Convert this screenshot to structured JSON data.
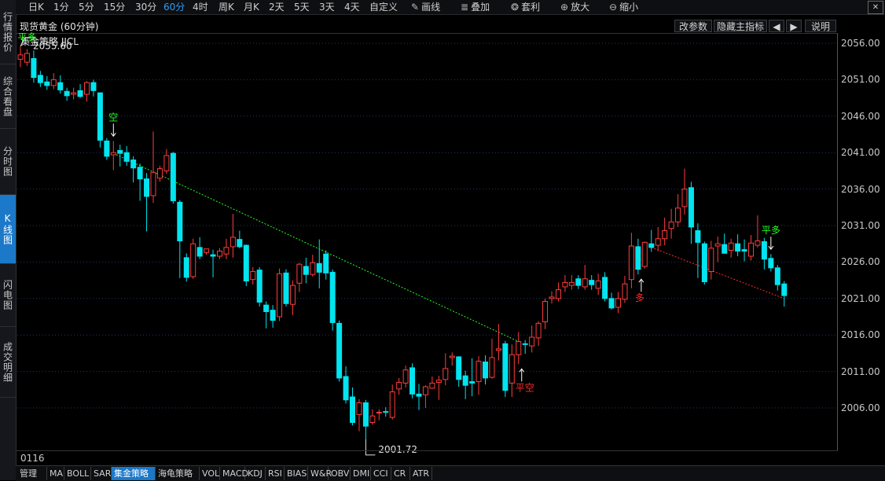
{
  "left_nav": [
    "行情报价",
    "综合看盘",
    "分时图",
    "K线图",
    "闪电图",
    "成交明细"
  ],
  "left_nav_active": 3,
  "periods": [
    "日K",
    "1分",
    "5分",
    "15分",
    "30分",
    "60分",
    "4时",
    "周K",
    "月K",
    "2天",
    "5天",
    "3天",
    "4天",
    "自定义"
  ],
  "period_active": 5,
  "tools": [
    {
      "label": "画线",
      "icon": "pencil-icon",
      "glyph": "✎"
    },
    {
      "label": "叠加",
      "icon": "stack-icon",
      "glyph": "≣"
    },
    {
      "label": "套利",
      "icon": "bag-icon",
      "glyph": "❂"
    },
    {
      "label": "放大",
      "icon": "zoom-in-icon",
      "glyph": "⊕"
    },
    {
      "label": "缩小",
      "icon": "zoom-out-icon",
      "glyph": "⊖"
    }
  ],
  "chart_title": "现货黄金 (60分钟)",
  "title_buttons": {
    "params": "改参数",
    "hide_main": "隐藏主指标",
    "prev": "◀",
    "next": "▶",
    "help": "说明"
  },
  "strategy_label": "集金策略 JJCL",
  "count": "0116",
  "bottom_tabs": [
    "管理",
    "MA",
    "BOLL",
    "SAR",
    "集金策略",
    "海龟策略",
    "VOL",
    "MACD",
    "KDJ",
    "RSI",
    "BIAS",
    "W&R",
    "OBV",
    "DMI",
    "CCI",
    "CR",
    "ATR"
  ],
  "bottom_tab_active": 4,
  "colors": {
    "up": "#ff3c3c",
    "down": "#00e5f0",
    "grid": "#1e3a5f",
    "signal_green": "#22ff22",
    "signal_red": "#ff2a2a"
  },
  "chart_data": {
    "type": "candlestick",
    "y_ticks": [
      "2056.00",
      "2051.00",
      "2046.00",
      "2041.00",
      "2036.00",
      "2031.00",
      "2026.00",
      "2021.00",
      "2016.00",
      "2011.00",
      "2006.00"
    ],
    "ylim": [
      2000,
      2058
    ],
    "high_label": "2055.60",
    "low_label": "2001.72",
    "candles": [
      [
        2053.8,
        2054.4,
        2055.6,
        2052.7
      ],
      [
        2053.4,
        2054.6,
        2055.2,
        2052.9
      ],
      [
        2053.9,
        2051.3,
        2055.0,
        2050.6
      ],
      [
        2051.6,
        2050.6,
        2052.2,
        2050.0
      ],
      [
        2050.7,
        2050.2,
        2051.5,
        2049.6
      ],
      [
        2050.2,
        2051.0,
        2051.9,
        2049.7
      ],
      [
        2050.6,
        2049.6,
        2051.6,
        2049.1
      ],
      [
        2049.4,
        2048.8,
        2049.9,
        2048.1
      ],
      [
        2049.0,
        2049.2,
        2049.9,
        2048.3
      ],
      [
        2049.5,
        2048.7,
        2050.4,
        2048.5
      ],
      [
        2049.0,
        2050.6,
        2050.8,
        2048.0
      ],
      [
        2050.6,
        2049.5,
        2051.0,
        2048.7
      ],
      [
        2049.2,
        2042.7,
        2049.2,
        2041.7
      ],
      [
        2042.6,
        2040.5,
        2043.0,
        2040.0
      ],
      [
        2040.7,
        2041.0,
        2042.6,
        2038.6
      ],
      [
        2041.3,
        2040.9,
        2042.1,
        2039.1
      ],
      [
        2041.0,
        2039.8,
        2041.9,
        2039.2
      ],
      [
        2040.0,
        2038.9,
        2040.5,
        2036.9
      ],
      [
        2039.0,
        2037.4,
        2039.5,
        2034.4
      ],
      [
        2037.4,
        2035.0,
        2038.2,
        2030.2
      ],
      [
        2035.1,
        2038.3,
        2043.9,
        2034.1
      ],
      [
        2037.5,
        2038.8,
        2039.2,
        2037.0
      ],
      [
        2038.5,
        2040.6,
        2041.5,
        2038.1
      ],
      [
        2040.9,
        2034.4,
        2041.1,
        2034.0
      ],
      [
        2034.2,
        2028.9,
        2034.5,
        2023.8
      ],
      [
        2026.6,
        2023.9,
        2027.2,
        2023.3
      ],
      [
        2024.0,
        2028.5,
        2029.2,
        2023.7
      ],
      [
        2028.0,
        2026.8,
        2029.4,
        2026.4
      ],
      [
        2027.3,
        2027.8,
        2027.8,
        2027.0
      ],
      [
        2027.0,
        2026.8,
        2027.7,
        2023.9
      ],
      [
        2026.8,
        2027.5,
        2027.9,
        2026.4
      ],
      [
        2027.1,
        2028.0,
        2029.2,
        2026.4
      ],
      [
        2028.1,
        2029.4,
        2032.6,
        2026.6
      ],
      [
        2029.1,
        2028.1,
        2030.3,
        2027.9
      ],
      [
        2028.3,
        2023.4,
        2028.4,
        2022.7
      ],
      [
        2023.6,
        2024.7,
        2025.3,
        2022.9
      ],
      [
        2024.9,
        2020.5,
        2025.3,
        2019.9
      ],
      [
        2020.1,
        2019.2,
        2020.6,
        2016.9
      ],
      [
        2019.4,
        2018.0,
        2020.1,
        2017.0
      ],
      [
        2018.5,
        2024.4,
        2025.1,
        2017.9
      ],
      [
        2024.5,
        2020.3,
        2025.0,
        2019.9
      ],
      [
        2020.2,
        2022.8,
        2023.5,
        2018.7
      ],
      [
        2023.1,
        2025.7,
        2025.9,
        2021.9
      ],
      [
        2025.4,
        2024.3,
        2026.6,
        2023.1
      ],
      [
        2024.3,
        2025.9,
        2027.0,
        2024.0
      ],
      [
        2025.8,
        2024.6,
        2029.1,
        2022.4
      ],
      [
        2027.1,
        2024.5,
        2027.6,
        2023.6
      ],
      [
        2024.6,
        2017.7,
        2025.0,
        2016.6
      ],
      [
        2017.6,
        2010.1,
        2018.0,
        2009.6
      ],
      [
        2010.3,
        2007.1,
        2011.7,
        2006.6
      ],
      [
        2007.5,
        2004.0,
        2008.8,
        2003.6
      ],
      [
        2005.1,
        2006.7,
        2007.2,
        2002.8
      ],
      [
        2006.7,
        2003.5,
        2007.1,
        2001.7
      ],
      [
        2004.0,
        2004.9,
        2005.8,
        2003.7
      ],
      [
        2005.3,
        2005.4,
        2005.8,
        2004.3
      ],
      [
        2005.5,
        2005.4,
        2006.1,
        2004.8
      ],
      [
        2004.7,
        2008.2,
        2009.2,
        2004.4
      ],
      [
        2008.6,
        2009.5,
        2010.1,
        2007.8
      ],
      [
        2009.4,
        2011.2,
        2011.8,
        2008.8
      ],
      [
        2011.5,
        2007.9,
        2012.1,
        2007.3
      ],
      [
        2007.9,
        2007.6,
        2009.3,
        2005.7
      ],
      [
        2007.8,
        2008.9,
        2009.1,
        2006.0
      ],
      [
        2008.7,
        2009.4,
        2010.3,
        2008.6
      ],
      [
        2009.5,
        2009.8,
        2010.4,
        2007.1
      ],
      [
        2009.9,
        2011.4,
        2013.5,
        2009.1
      ],
      [
        2012.9,
        2013.1,
        2013.6,
        2011.8
      ],
      [
        2013.0,
        2009.9,
        2013.1,
        2008.9
      ],
      [
        2010.4,
        2009.1,
        2011.1,
        2007.2
      ],
      [
        2009.6,
        2009.4,
        2012.8,
        2007.6
      ],
      [
        2009.6,
        2012.4,
        2013.1,
        2007.8
      ],
      [
        2012.3,
        2010.1,
        2013.2,
        2009.2
      ],
      [
        2010.2,
        2012.9,
        2015.5,
        2010.0
      ],
      [
        2013.9,
        2014.1,
        2017.5,
        2012.5
      ],
      [
        2014.8,
        2008.4,
        2015.2,
        2007.5
      ],
      [
        2009.4,
        2013.3,
        2014.7,
        2007.5
      ],
      [
        2013.3,
        2015.1,
        2016.4,
        2012.0
      ],
      [
        2014.8,
        2014.7,
        2015.3,
        2013.4
      ],
      [
        2014.5,
        2015.7,
        2017.3,
        2013.6
      ],
      [
        2015.6,
        2017.6,
        2017.9,
        2014.5
      ],
      [
        2017.8,
        2020.6,
        2021.0,
        2016.8
      ],
      [
        2021.0,
        2021.2,
        2022.0,
        2020.3
      ],
      [
        2021.0,
        2022.2,
        2023.2,
        2020.6
      ],
      [
        2022.6,
        2023.2,
        2024.2,
        2021.9
      ],
      [
        2022.8,
        2023.2,
        2024.2,
        2022.2
      ],
      [
        2023.7,
        2022.8,
        2024.2,
        2022.3
      ],
      [
        2022.6,
        2023.7,
        2025.6,
        2022.2
      ],
      [
        2023.5,
        2022.9,
        2024.2,
        2022.2
      ],
      [
        2022.4,
        2023.4,
        2024.4,
        2021.5
      ],
      [
        2023.9,
        2021.0,
        2024.6,
        2020.6
      ],
      [
        2021.0,
        2019.7,
        2021.8,
        2019.5
      ],
      [
        2019.8,
        2021.0,
        2021.9,
        2019.0
      ],
      [
        2020.9,
        2023.0,
        2024.1,
        2020.4
      ],
      [
        2023.6,
        2028.2,
        2030.0,
        2022.4
      ],
      [
        2028.1,
        2025.0,
        2029.2,
        2024.3
      ],
      [
        2025.4,
        2028.7,
        2028.8,
        2025.1
      ],
      [
        2028.5,
        2028.0,
        2030.4,
        2027.4
      ],
      [
        2028.3,
        2029.2,
        2030.8,
        2027.5
      ],
      [
        2029.2,
        2030.3,
        2032.1,
        2028.3
      ],
      [
        2030.6,
        2031.5,
        2033.3,
        2029.2
      ],
      [
        2031.5,
        2033.4,
        2035.3,
        2030.8
      ],
      [
        2033.6,
        2036.0,
        2038.8,
        2032.5
      ],
      [
        2036.2,
        2030.8,
        2037.0,
        2028.5
      ],
      [
        2030.3,
        2028.7,
        2031.3,
        2023.8
      ],
      [
        2028.5,
        2023.3,
        2028.8,
        2022.9
      ],
      [
        2024.7,
        2027.9,
        2028.9,
        2023.6
      ],
      [
        2028.2,
        2028.5,
        2029.5,
        2026.0
      ],
      [
        2028.4,
        2027.2,
        2029.9,
        2027.4
      ],
      [
        2027.6,
        2028.6,
        2029.2,
        2026.6
      ],
      [
        2028.5,
        2027.5,
        2029.8,
        2026.8
      ],
      [
        2027.7,
        2027.5,
        2029.1,
        2026.1
      ],
      [
        2026.8,
        2028.6,
        2029.7,
        2026.2
      ],
      [
        2028.3,
        2028.9,
        2032.4,
        2028.0
      ],
      [
        2028.8,
        2026.4,
        2029.3,
        2025.0
      ],
      [
        2026.5,
        2025.2,
        2027.1,
        2024.7
      ],
      [
        2025.2,
        2022.9,
        2025.6,
        2022.1
      ],
      [
        2023.0,
        2021.4,
        2023.4,
        2019.9
      ]
    ],
    "markers": [
      {
        "type": "sell-open",
        "label": "空",
        "index": 14
      },
      {
        "type": "close-short",
        "label": "平空",
        "index": 75
      },
      {
        "type": "buy-open",
        "label": "多",
        "index": 93
      },
      {
        "type": "close-long",
        "label": "平多",
        "index": 113
      },
      {
        "type": "close-long",
        "label": "平多",
        "index": 1
      }
    ],
    "trend_lines": [
      {
        "color": "green",
        "from_index": 14,
        "from_price": 2040.9,
        "to_index": 75,
        "to_price": 2015.1
      },
      {
        "color": "red",
        "from_index": 95,
        "from_price": 2028.0,
        "to_index": 115,
        "to_price": 2021.0
      }
    ]
  }
}
